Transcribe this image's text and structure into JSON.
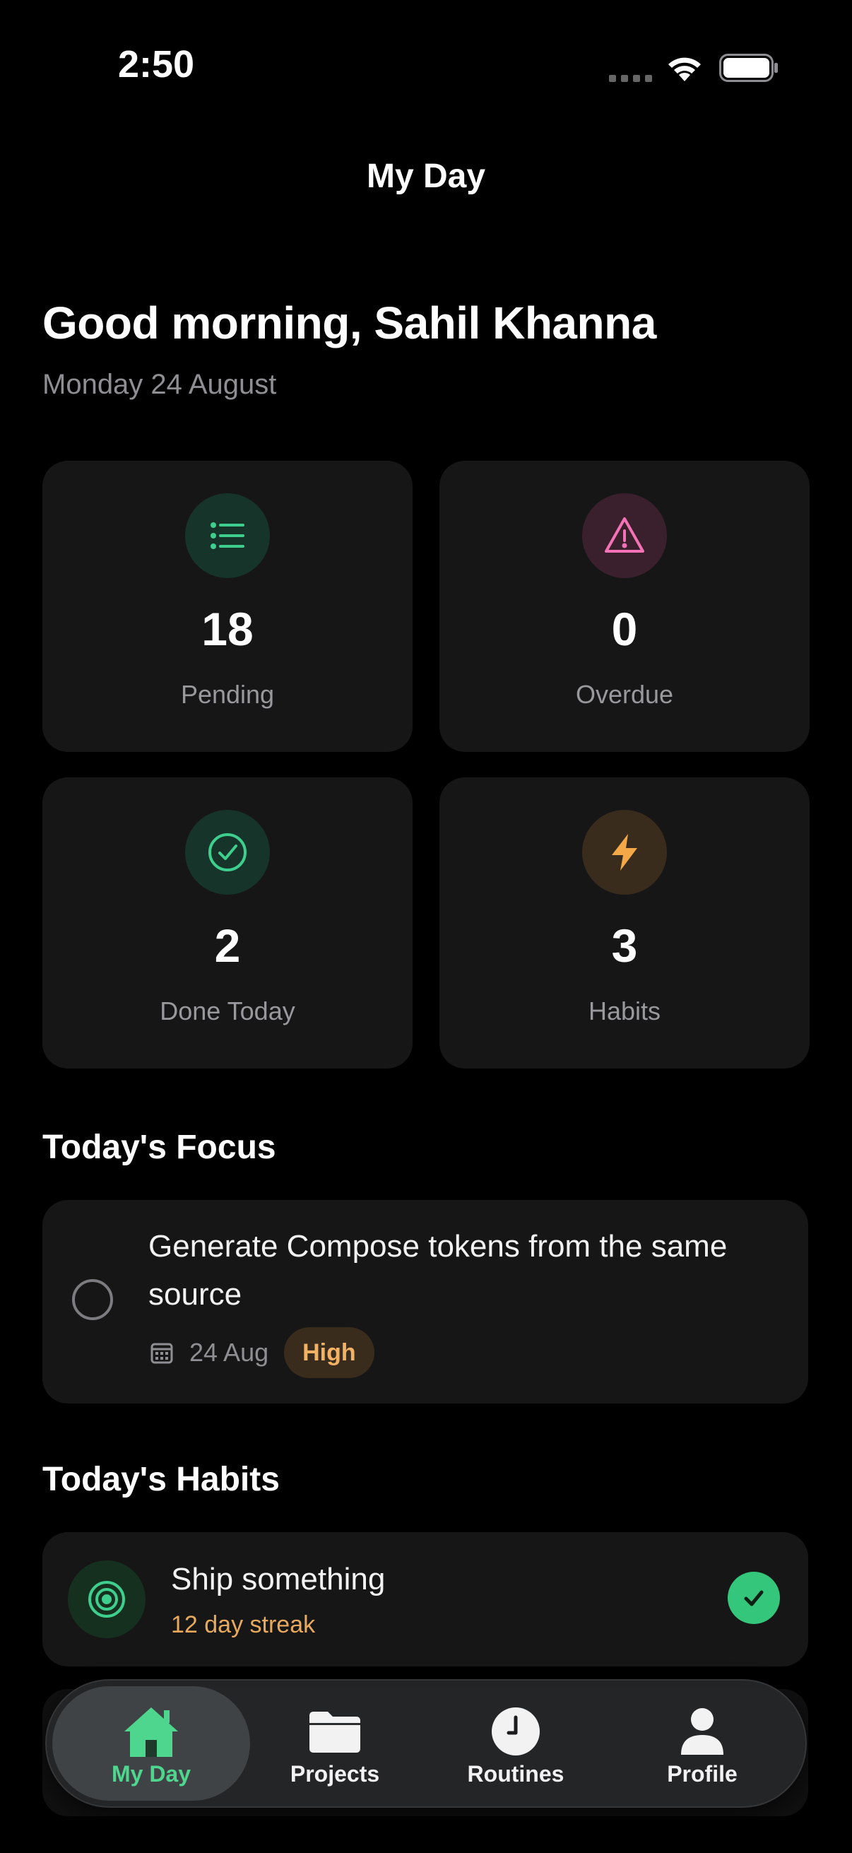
{
  "status_bar": {
    "time": "2:50"
  },
  "nav": {
    "title": "My Day"
  },
  "header": {
    "greeting": "Good morning, Sahil Khanna",
    "date": "Monday 24 August"
  },
  "stats": [
    {
      "value": "18",
      "label": "Pending",
      "icon": "list-icon",
      "color": "#3ecf8e"
    },
    {
      "value": "0",
      "label": "Overdue",
      "icon": "warning-icon",
      "color": "#f472b6"
    },
    {
      "value": "2",
      "label": "Done Today",
      "icon": "check-circle-icon",
      "color": "#3ecf8e"
    },
    {
      "value": "3",
      "label": "Habits",
      "icon": "bolt-icon",
      "color": "#f5a847"
    }
  ],
  "focus": {
    "section_title": "Today's Focus",
    "task": {
      "title": "Generate Compose tokens from the same source",
      "date": "24 Aug",
      "priority": "High"
    }
  },
  "habits": {
    "section_title": "Today's Habits",
    "items": [
      {
        "title": "Ship something",
        "streak": "12 day streak",
        "done": true
      }
    ]
  },
  "tabbar": {
    "accent": "#4fd68e",
    "tabs": [
      {
        "label": "My Day",
        "icon": "home-icon",
        "active": true
      },
      {
        "label": "Projects",
        "icon": "folder-icon",
        "active": false
      },
      {
        "label": "Routines",
        "icon": "clock-icon",
        "active": false
      },
      {
        "label": "Profile",
        "icon": "person-icon",
        "active": false
      }
    ]
  }
}
